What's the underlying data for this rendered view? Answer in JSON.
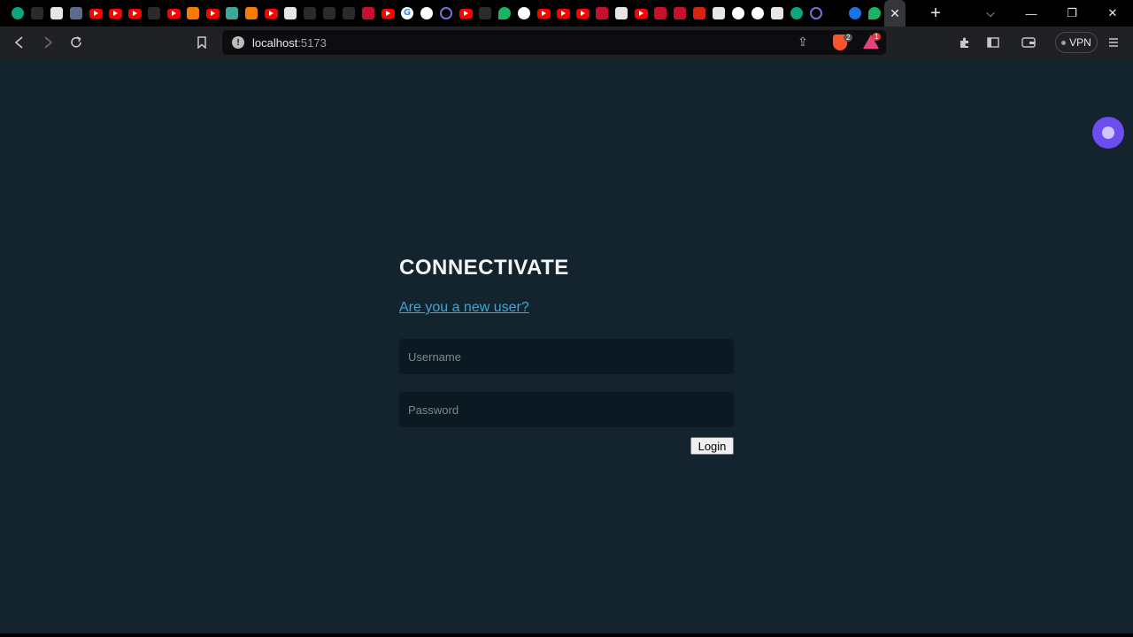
{
  "browser": {
    "tab_icons": [
      "gpt-icon",
      "figma-icon",
      "x-icon",
      "shield-icon",
      "youtube-icon",
      "youtube-icon",
      "youtube-icon",
      "patreon-icon",
      "youtube-icon",
      "blogger-icon",
      "youtube-icon",
      "dev-icon",
      "multicolor-icon",
      "youtube-icon",
      "gx-icon",
      "medium-icon",
      "dots-icon",
      "circle-icon",
      "news-icon",
      "youtube-icon",
      "google-icon",
      "github-icon",
      "cloud-icon",
      "youtube-icon",
      "ast-icon",
      "vue-icon",
      "github-icon",
      "youtube-icon",
      "youtube-icon",
      "youtube-icon",
      "fire-icon",
      "gmail-icon",
      "youtube-icon",
      "news-icon",
      "n-icon",
      "pdf-icon",
      "window-icon",
      "openai-icon",
      "github-icon",
      "image-icon",
      "gpt-icon",
      "power-icon",
      "blank-icon",
      "blue-icon",
      "leaf-icon"
    ],
    "active_tab_close": "✕",
    "new_tab": "+",
    "address": {
      "host": "localhost",
      "port": ":5173"
    },
    "brave_shields_count": "2",
    "rewards_count": "1",
    "vpn_label": "VPN"
  },
  "login": {
    "title": "CONNECTIVATE",
    "signup_link": "Are you a new user?",
    "username_placeholder": "Username",
    "password_placeholder": "Password",
    "submit_label": "Login"
  },
  "colors": {
    "page_background": "#13242f",
    "link": "#3ea6d6",
    "input_background": "#0c1922",
    "assistant_orb": "#6d4cf0"
  }
}
